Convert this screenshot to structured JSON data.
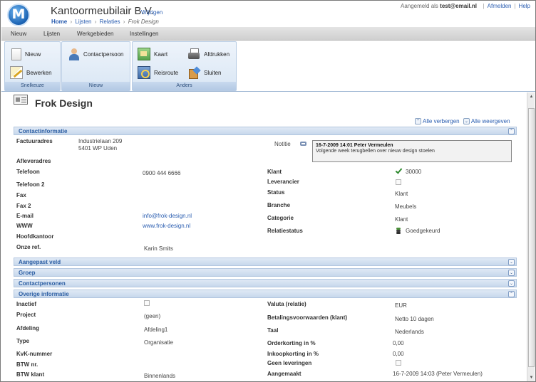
{
  "header": {
    "logo_letter": "M",
    "company": "Kantoormeubilair B.V.",
    "change_link": "Wijzigen",
    "breadcrumb": {
      "home": "Home",
      "sep": "›",
      "lists": "Lijsten",
      "relations": "Relaties",
      "current": "Frok Design"
    },
    "logged_in_prefix": "Aangemeld als",
    "user_email": "test@email.nl",
    "logout": "Afmelden",
    "help": "Help",
    "link_sep": "|"
  },
  "menubar": {
    "items": [
      "Nieuw",
      "Lijsten",
      "Werkgebieden",
      "Instellingen"
    ]
  },
  "ribbon": {
    "groups": {
      "quick": {
        "label": "Snelkeuze",
        "new": "Nieuw",
        "edit": "Bewerken"
      },
      "new": {
        "label": "Nieuw",
        "contact": "Contactpersoon"
      },
      "other": {
        "label": "Anders",
        "map": "Kaart",
        "print": "Afdrukken",
        "route": "Reisroute",
        "close": "Sluiten"
      }
    }
  },
  "page": {
    "title": "Frok Design",
    "hide_all": "Alle verbergen",
    "show_all": "Alle weergeven"
  },
  "sections": {
    "contact": "Contactinformatie",
    "custom": "Aangepast veld",
    "group": "Groep",
    "contacts": "Contactpersonen",
    "other": "Overige informatie"
  },
  "contact": {
    "factuuradres_label": "Factuuradres",
    "factuuradres_line1": "Industrielaan 209",
    "factuuradres_line2": "5401 WP Uden",
    "afleveradres_label": "Afleveradres",
    "telefoon_label": "Telefoon",
    "telefoon": "0900 444 6666",
    "telefoon2_label": "Telefoon 2",
    "fax_label": "Fax",
    "fax2_label": "Fax 2",
    "email_label": "E-mail",
    "email": "info@frok-design.nl",
    "www_label": "WWW",
    "www": "www.frok-design.nl",
    "hoofdkantoor_label": "Hoofdkantoor",
    "onzeref_label": "Onze ref.",
    "onzeref": "Karin Smits",
    "notitie_label": "Notitie",
    "note_header": "16-7-2009 14:01 Peter Vermeulen",
    "note_body": "Volgende week terugbellen over nieuw design stoelen",
    "klant_label": "Klant",
    "klant_value": "30000",
    "leverancier_label": "Leverancier",
    "status_label": "Status",
    "status": "Klant",
    "branche_label": "Branche",
    "branche": "Meubels",
    "categorie_label": "Categorie",
    "categorie": "Klant",
    "relatiestatus_label": "Relatiestatus",
    "relatiestatus": "Goedgekeurd"
  },
  "other": {
    "inactief_label": "Inactief",
    "project_label": "Project",
    "project": "(geen)",
    "afdeling_label": "Afdeling",
    "afdeling": "Afdeling1",
    "type_label": "Type",
    "type": "Organisatie",
    "kvk_label": "KvK-nummer",
    "btw_label": "BTW nr.",
    "btwklant_label": "BTW klant",
    "btwklant": "Binnenlands",
    "valuta_label": "Valuta (relatie)",
    "valuta": "EUR",
    "betaling_label": "Betalingsvoorwaarden (klant)",
    "betaling": "Netto 10 dagen",
    "taal_label": "Taal",
    "taal": "Nederlands",
    "orderkorting_label": "Orderkorting in %",
    "orderkorting": "0,00",
    "inkoopkorting_label": "Inkoopkorting in %",
    "inkoopkorting": "0,00",
    "geenlev_label": "Geen leveringen",
    "aangemaakt_label": "Aangemaakt",
    "aangemaakt": "16-7-2009 14:03 (Peter Vermeulen)"
  },
  "icons": {
    "toggle_up": "double-chevron-up",
    "toggle_down": "double-chevron-down"
  }
}
